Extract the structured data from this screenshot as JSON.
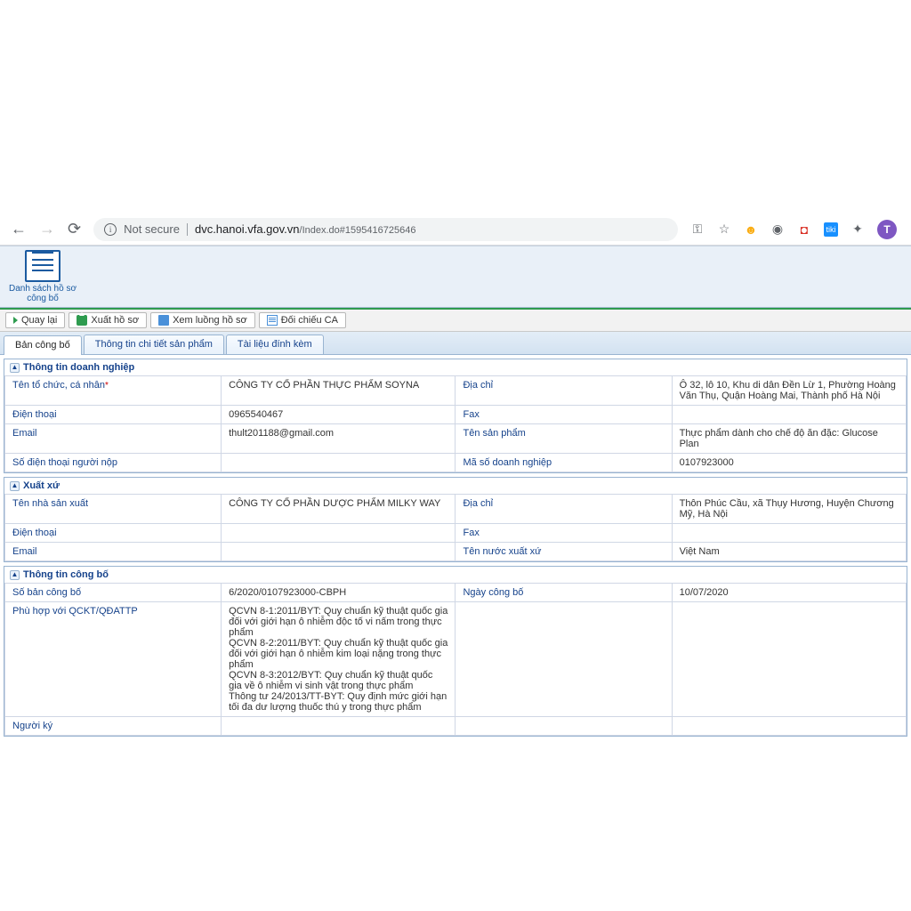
{
  "browser": {
    "not_secure": "Not secure",
    "url_host": "dvc.hanoi.vfa.gov.vn",
    "url_path": "/Index.do#1595416725646",
    "avatar_letter": "T"
  },
  "header": {
    "big_button": "Danh sách hồ sơ công bố"
  },
  "toolbar": {
    "back": "Quay lại",
    "export": "Xuất hồ sơ",
    "flow": "Xem luồng hồ sơ",
    "compare": "Đối chiếu CA"
  },
  "tabs": {
    "t1": "Bản công bố",
    "t2": "Thông tin chi tiết sản phẩm",
    "t3": "Tài liệu đính kèm"
  },
  "sections": {
    "company": {
      "title": "Thông tin doanh nghiệp",
      "org_name_lbl": "Tên tổ chức, cá nhân",
      "org_name": "CÔNG TY CỔ PHẦN THỰC PHẨM SOYNA",
      "address_lbl": "Địa chỉ",
      "address": "Ô 32, lô 10, Khu di dân Đền Lừ 1, Phường Hoàng Văn Thụ, Quận Hoàng Mai, Thành phố Hà Nội",
      "phone_lbl": "Điện thoại",
      "phone": "0965540467",
      "fax_lbl": "Fax",
      "fax": "",
      "email_lbl": "Email",
      "email": "thult201188@gmail.com",
      "product_lbl": "Tên sản phẩm",
      "product": "Thực phẩm dành cho chế độ ăn đặc: Glucose Plan",
      "submitter_phone_lbl": "Số điện thoại người nộp",
      "submitter_phone": "",
      "enterprise_code_lbl": "Mã số doanh nghiệp",
      "enterprise_code": "0107923000"
    },
    "origin": {
      "title": "Xuất xứ",
      "manufacturer_lbl": "Tên nhà sản xuất",
      "manufacturer": "CÔNG TY CỔ PHẦN DƯỢC PHẨM MILKY WAY",
      "address_lbl": "Địa chỉ",
      "address": "Thôn Phúc Cầu, xã Thụy Hương, Huyện Chương Mỹ, Hà Nội",
      "phone_lbl": "Điện thoại",
      "phone": "",
      "fax_lbl": "Fax",
      "fax": "",
      "email_lbl": "Email",
      "email": "",
      "country_lbl": "Tên nước xuất xứ",
      "country": "Việt Nam"
    },
    "announcement": {
      "title": "Thông tin công bố",
      "no_lbl": "Số bản công bố",
      "no": "6/2020/0107923000-CBPH",
      "date_lbl": "Ngày công bố",
      "date": "10/07/2020",
      "conform_lbl": "Phù hợp với QCKT/QĐATTP",
      "conform": "QCVN 8-1:2011/BYT: Quy chuẩn kỹ thuật quốc gia đối với giới hạn ô nhiễm độc tố vi nấm trong thực phẩm\nQCVN 8-2:2011/BYT: Quy chuẩn kỹ thuật quốc gia đối với giới hạn ô nhiễm kim loại nặng trong thực phẩm\nQCVN 8-3:2012/BYT: Quy chuẩn kỹ thuật quốc gia về ô nhiễm vi sinh vật trong thực phẩm\nThông tư 24/2013/TT-BYT: Quy định mức giới hạn tối đa dư lượng thuốc thú y trong thực phẩm",
      "signer_lbl": "Người ký",
      "signer": ""
    }
  }
}
